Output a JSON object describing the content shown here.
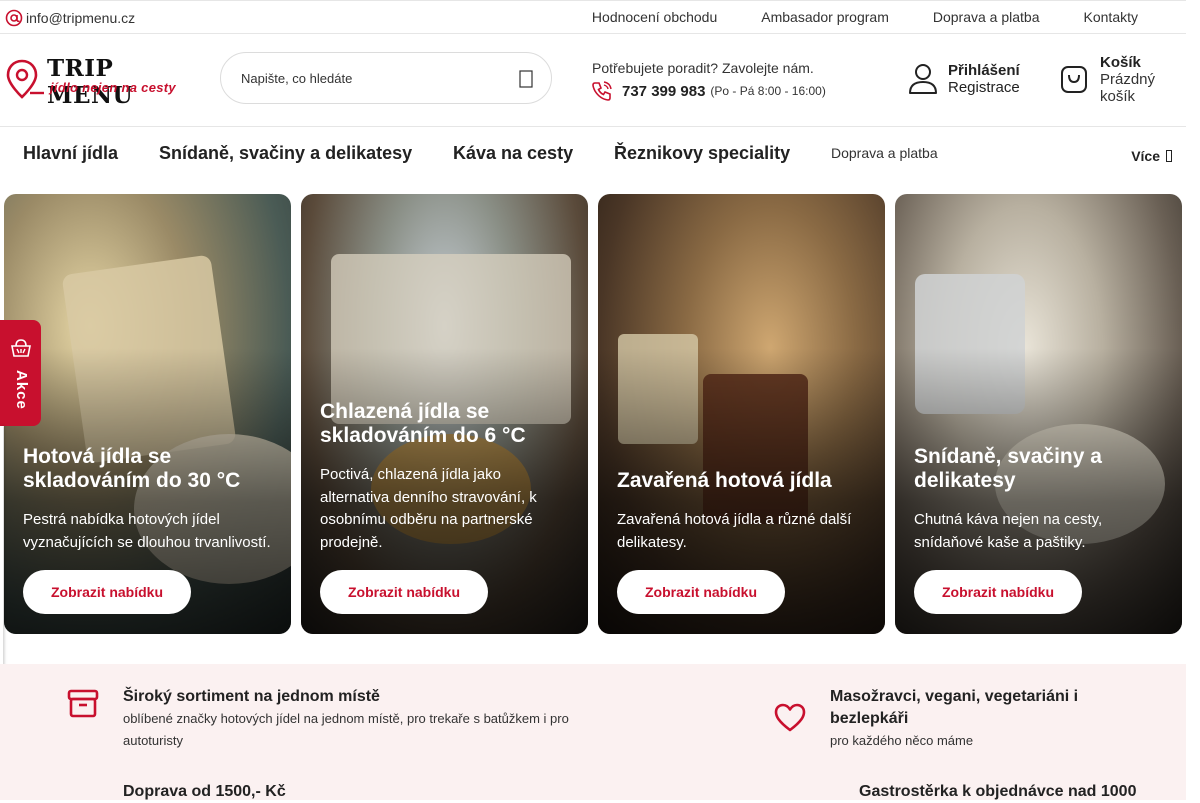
{
  "topbar": {
    "email": "info@tripmenu.cz",
    "links": [
      "Hodnocení obchodu",
      "Ambasador program",
      "Doprava a platba",
      "Kontakty"
    ]
  },
  "logo": {
    "brand": "TRIP MENU",
    "tagline": "jídlo nejen na cesty"
  },
  "search": {
    "placeholder": "Napište, co hledáte",
    "icon": "search-icon"
  },
  "help": {
    "text": "Potřebujete poradit? Zavolejte nám.",
    "phone": "737 399 983",
    "hours": "(Po - Pá 8:00 - 16:00)"
  },
  "account": {
    "login": "Přihlášení",
    "register": "Registrace"
  },
  "cart": {
    "title": "Košík",
    "status_line1": "Prázdný",
    "status_line2": "košík"
  },
  "nav": {
    "items": [
      "Hlavní jídla",
      "Snídaně, svačiny a delikatesy",
      "Káva na cesty",
      "Řeznikovy speciality"
    ],
    "small": "Doprava a platba",
    "more": "Více"
  },
  "akce": {
    "label": "Akce"
  },
  "cards": [
    {
      "title": "Hotová jídla se skladováním do 30 °C",
      "text": "Pestrá nabídka hotových jídel vyznačujících se dlouhou trvanlivostí.",
      "button": "Zobrazit nabídku"
    },
    {
      "title": "Chlazená jídla se skladováním do 6 °C",
      "text": "Poctivá, chlazená jídla jako alternativa denního stravování, k osobnímu odběru na partnerské prodejně.",
      "button": "Zobrazit nabídku"
    },
    {
      "title": "Zavařená hotová jídla",
      "text": "Zavařená hotová jídla a různé další delikatesy.",
      "button": "Zobrazit nabídku"
    },
    {
      "title": "Snídaně, svačiny a delikatesy",
      "text": "Chutná káva nejen na cesty, snídaňové kaše a paštiky.",
      "button": "Zobrazit nabídku"
    }
  ],
  "benefits": [
    {
      "title": "Široký sortiment na jednom místě",
      "text": "oblíbené značky hotových jídel na jednom místě, pro trekaře s batůžkem i pro autoturisty",
      "icon": "box-icon"
    },
    {
      "title": "Masožravci, vegani, vegetariáni i bezlepkáři",
      "text": "pro každého něco máme",
      "icon": "heart-icon"
    },
    {
      "title": "Doprava od 1500,- Kč",
      "text": ""
    },
    {
      "title": "Gastrostěrka k objednávce nad 1000",
      "text": ""
    }
  ],
  "colors": {
    "accent": "#c8102e",
    "band": "#fbf1f1"
  }
}
